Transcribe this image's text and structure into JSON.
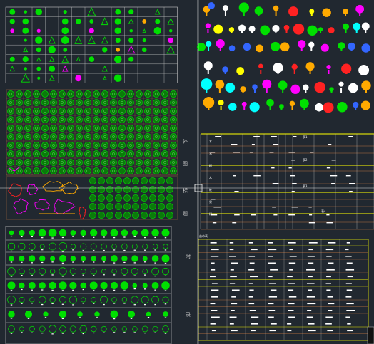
{
  "drawing": {
    "background": "#212830",
    "line_color": "#c8c8c8",
    "accent_green": "#00e000",
    "accent_yellow": "#ffff00",
    "accent_magenta": "#ff00ff",
    "accent_blue": "#3366ff",
    "accent_red": "#ff2222",
    "accent_cyan": "#00ffff",
    "accent_orange": "#ffaa00",
    "grid_orange": "#b87040"
  },
  "side_labels": {
    "l1": "外",
    "l2": "图",
    "l3": "标",
    "l4": "题",
    "l5": "附",
    "l6": "录"
  },
  "tables": {
    "upper_header_1": "表1",
    "upper_header_2": "表2",
    "upper_header_3": "表3",
    "upper_header_4": "表4",
    "lower_title": "苗木表",
    "upper_rows": [
      "木",
      "名",
      "树",
      "木",
      "桩",
      "果",
      "树"
    ]
  },
  "icons": {
    "crosshair": "crosshair-cursor-icon"
  }
}
